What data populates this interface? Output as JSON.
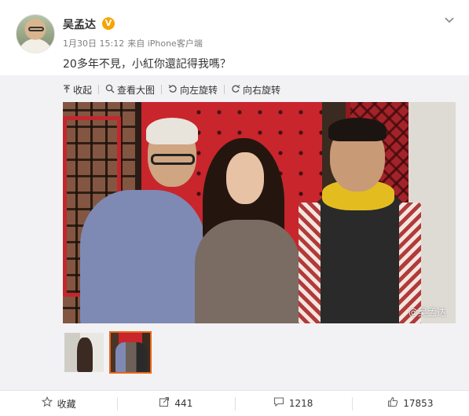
{
  "post": {
    "author": "吴孟达",
    "verified_badge": "V",
    "date": "1月30日 15:12",
    "source": "来自 iPhone客户端",
    "text": "20多年不見，小紅你還記得我嗎？",
    "menu_icon": "chevron-down-icon"
  },
  "toolbar": {
    "collapse": "收起",
    "view_large": "查看大图",
    "rotate_left": "向左旋转",
    "rotate_right": "向右旋转"
  },
  "photo": {
    "watermark": "@吴孟达"
  },
  "thumbnails": [
    {
      "selected": false
    },
    {
      "selected": true
    }
  ],
  "actions": {
    "favorite": "收藏",
    "repost_count": "441",
    "comment_count": "1218",
    "like_count": "17853"
  },
  "colors": {
    "accent_orange": "#e8641b",
    "verified": "#f7a400"
  }
}
